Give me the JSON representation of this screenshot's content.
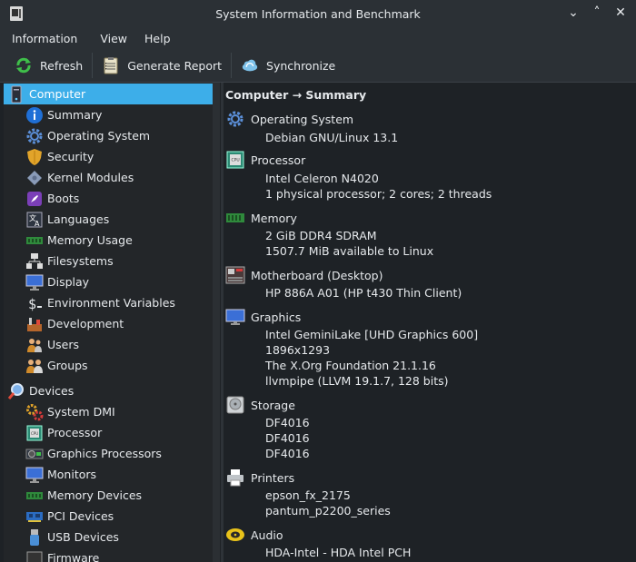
{
  "window": {
    "title": "System Information and Benchmark"
  },
  "menu": {
    "items": [
      "Information",
      "View",
      "Help"
    ]
  },
  "toolbar": {
    "refresh_label": "Refresh",
    "report_label": "Generate Report",
    "sync_label": "Synchronize"
  },
  "sidebar": {
    "computer": "Computer",
    "computer_items": [
      "Summary",
      "Operating System",
      "Security",
      "Kernel Modules",
      "Boots",
      "Languages",
      "Memory Usage",
      "Filesystems",
      "Display",
      "Environment Variables",
      "Development",
      "Users",
      "Groups"
    ],
    "devices": "Devices",
    "devices_items": [
      "System DMI",
      "Processor",
      "Graphics Processors",
      "Monitors",
      "Memory Devices",
      "PCI Devices",
      "USB Devices",
      "Firmware"
    ]
  },
  "main": {
    "heading": "Computer → Summary",
    "sections": [
      {
        "title": "Operating System",
        "icon": "gear-icon",
        "rows": [
          "Debian GNU/Linux 13.1"
        ]
      },
      {
        "title": "Processor",
        "icon": "cpu-icon",
        "rows": [
          "Intel Celeron N4020",
          "1 physical processor; 2 cores; 2 threads"
        ]
      },
      {
        "title": "Memory",
        "icon": "memory-icon",
        "rows": [
          "2 GiB DDR4 SDRAM",
          "1507.7 MiB available to Linux"
        ]
      },
      {
        "title": "Motherboard (Desktop)",
        "icon": "motherboard-icon",
        "rows": [
          "HP 886A A01 (HP t430 Thin Client)"
        ]
      },
      {
        "title": "Graphics",
        "icon": "monitor-icon",
        "rows": [
          "Intel GeminiLake [UHD Graphics 600]",
          "1896x1293",
          "The X.Org Foundation 21.1.16",
          "llvmpipe (LLVM 19.1.7, 128 bits)"
        ]
      },
      {
        "title": "Storage",
        "icon": "disk-icon",
        "rows": [
          "DF4016",
          "DF4016",
          "DF4016"
        ]
      },
      {
        "title": "Printers",
        "icon": "printer-icon",
        "rows": [
          "epson_fx_2175",
          "pantum_p2200_series"
        ]
      },
      {
        "title": "Audio",
        "icon": "audio-icon",
        "rows": [
          "HDA-Intel - HDA Intel PCH"
        ]
      }
    ]
  }
}
